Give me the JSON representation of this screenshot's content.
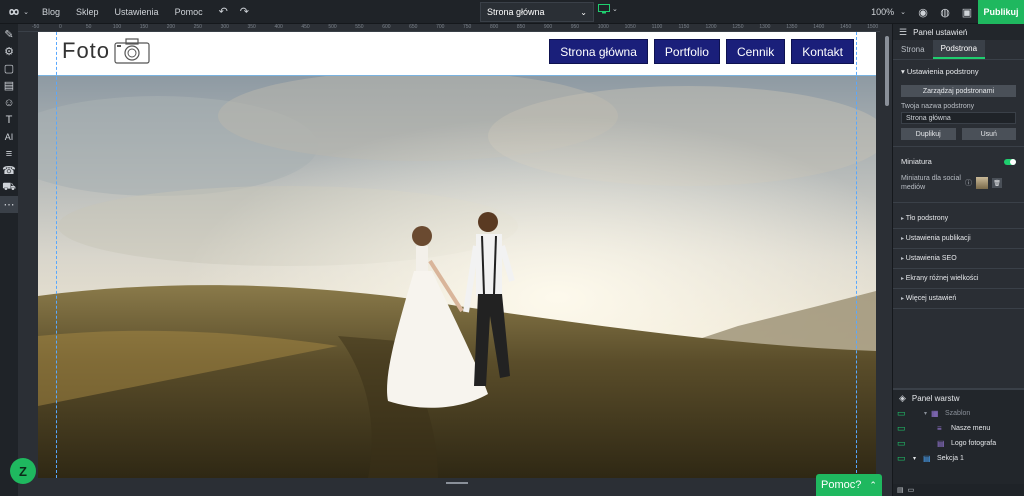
{
  "topbar": {
    "menu": [
      "Blog",
      "Sklep",
      "Ustawienia",
      "Pomoc"
    ],
    "page_select": "Strona główna",
    "zoom": "100%",
    "publish": "Publikuj"
  },
  "ruler_ticks": [
    "-50",
    "0",
    "50",
    "100",
    "150",
    "200",
    "250",
    "300",
    "350",
    "400",
    "450",
    "500",
    "550",
    "600",
    "650",
    "700",
    "750",
    "800",
    "850",
    "900",
    "950",
    "1000",
    "1050",
    "1100",
    "1150",
    "1200",
    "1250",
    "1300",
    "1350",
    "1400",
    "1450",
    "1500"
  ],
  "site": {
    "logo_text": "Foto",
    "nav": [
      "Strona główna",
      "Portfolio",
      "Cennik",
      "Kontakt"
    ]
  },
  "panel": {
    "title": "Panel ustawień",
    "tabs": [
      "Strona",
      "Podstrona"
    ],
    "section_title": "Ustawienia podstrony",
    "manage_button": "Zarządzaj podstronami",
    "name_label": "Twoja nazwa podstrony",
    "name_value": "Strona główna",
    "duplicate_button": "Duplikuj",
    "delete_button": "Usuń",
    "thumbnail_label": "Miniatura",
    "thumbnail_social": "Miniatura dla social mediów",
    "collapsibles": [
      "Tło podstrony",
      "Ustawienia publikacji",
      "Ustawienia SEO",
      "Ekrany różnej wielkości",
      "Więcej ustawień"
    ]
  },
  "layers": {
    "title": "Panel warstw",
    "items": [
      {
        "label": "Szablon",
        "dim": true,
        "level": 1
      },
      {
        "label": "Nasze menu",
        "dim": false,
        "level": 2
      },
      {
        "label": "Logo fotografa",
        "dim": false,
        "level": 2
      },
      {
        "label": "Sekcja 1",
        "dim": false,
        "level": 0
      }
    ]
  },
  "help": {
    "label": "Pomoc?"
  },
  "colors": {
    "accent": "#1fb85f",
    "nav_bg": "#1a1f7a",
    "guide": "#58a8ff"
  }
}
